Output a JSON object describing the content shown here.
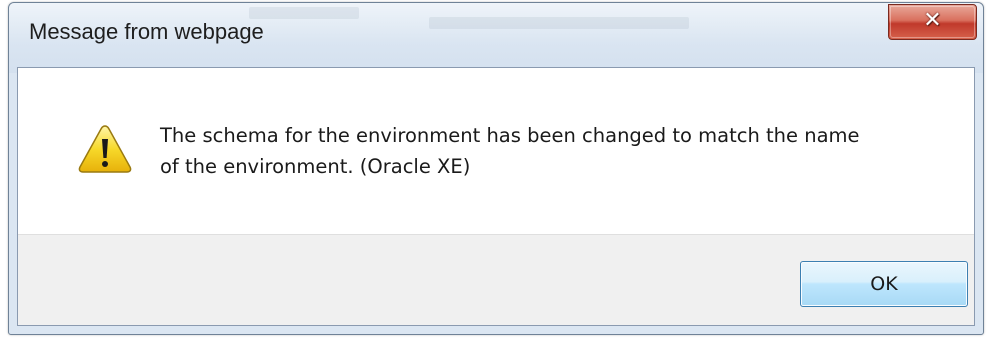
{
  "dialog": {
    "title": "Message from webpage",
    "close_glyph": "✕",
    "icon": "warning-icon",
    "message_line1": "The schema for the environment has been changed to match the name",
    "message_line2": "of the environment.  (Oracle XE)",
    "ok_label": "OK"
  },
  "colors": {
    "close_button": "#c0392b",
    "ok_border": "#3c7fb1",
    "button_bar": "#f0f0f0",
    "warning_fill": "#f5d21a"
  }
}
